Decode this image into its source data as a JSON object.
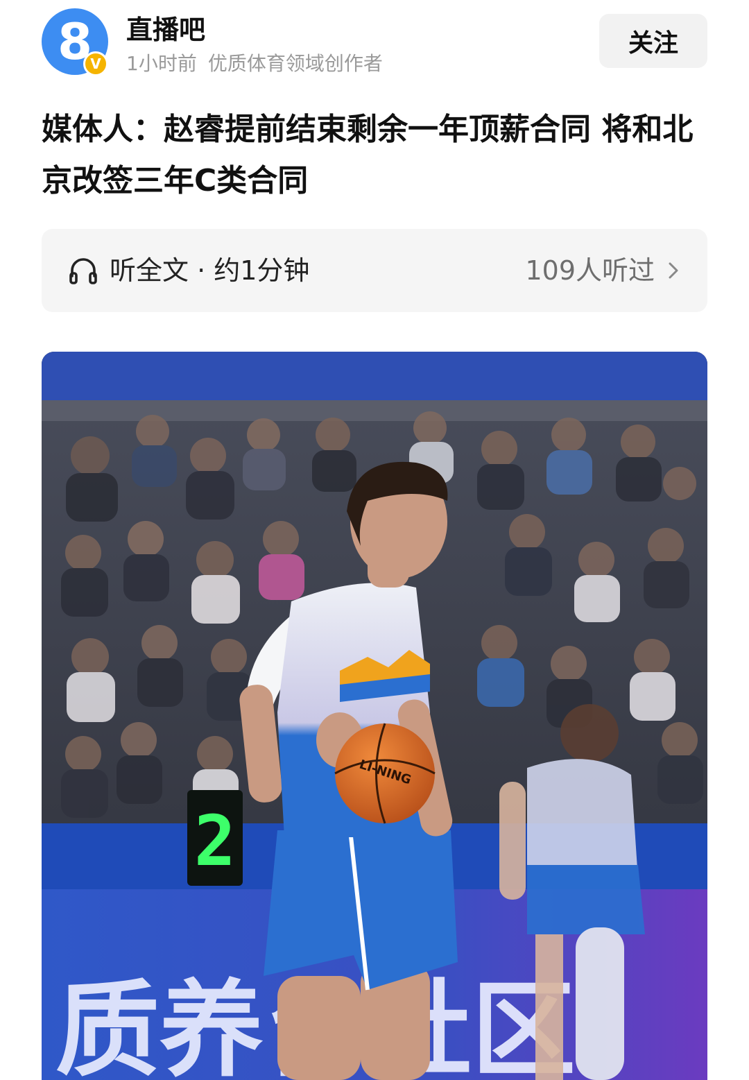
{
  "author": {
    "name": "直播吧",
    "time": "1小时前",
    "role": "优质体育领域创作者",
    "avatar_glyph": "8",
    "verified_glyph": "V",
    "follow_label": "关注"
  },
  "article": {
    "title": "媒体人：赵睿提前结束剩余一年顶薪合同 将和北京改签三年C类合同"
  },
  "listen": {
    "label": "听全文 · 约1分钟",
    "count": "109人听过",
    "icon": "headphones-icon"
  },
  "photo": {
    "shot_clock": "2",
    "ball_brand": "LI-NING",
    "ad_text": "质养台社区"
  },
  "colors": {
    "accent_blue": "#3d8df2",
    "badge_gold": "#f5b400",
    "jersey_blue": "#2b6fd0",
    "shot_clock_green": "#3dff6a"
  }
}
